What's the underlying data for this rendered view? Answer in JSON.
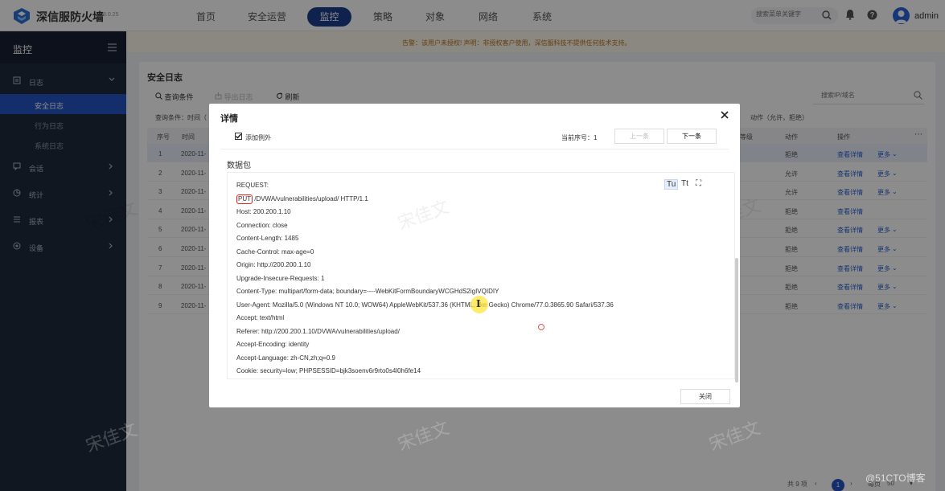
{
  "header": {
    "brand": "深信服防火墙",
    "version": "8.0.25",
    "nav": [
      "首页",
      "安全运营",
      "监控",
      "策略",
      "对象",
      "网络",
      "系统"
    ],
    "nav_active": "监控",
    "search_placeholder": "搜索菜单关键字",
    "username": "admin"
  },
  "sidebar": {
    "title": "监控",
    "items": [
      {
        "label": "日志",
        "icon": "log-icon"
      },
      {
        "label": "会话",
        "icon": "session-icon"
      },
      {
        "label": "统计",
        "icon": "stats-icon"
      },
      {
        "label": "报表",
        "icon": "report-icon"
      },
      {
        "label": "设备",
        "icon": "device-icon"
      }
    ],
    "subitems": [
      "安全日志",
      "行为日志",
      "系统日志"
    ],
    "active_subitem": "安全日志"
  },
  "notice": "告警：该用户未授权!  声明：非授权客户使用，深信服科技不提供任何技术支持。",
  "panel": {
    "title": "安全日志",
    "toolbar": [
      "查询条件",
      "导出日志",
      "刷新"
    ],
    "search_placeholder": "搜索IP/域名",
    "condition": "查询条件：时间（",
    "condition_right": "动作（允许，拒绝）",
    "columns": [
      "序号",
      "时间",
      "等级",
      "动作",
      "操作"
    ],
    "rows": [
      {
        "no": "1",
        "time": "2020-11-",
        "action": "拒绝",
        "op1": "查看详情",
        "op2": "更多"
      },
      {
        "no": "2",
        "time": "2020-11-",
        "action": "允许",
        "op1": "查看详情",
        "op2": "更多"
      },
      {
        "no": "3",
        "time": "2020-11-",
        "action": "允许",
        "op1": "查看详情",
        "op2": "更多"
      },
      {
        "no": "4",
        "time": "2020-11-",
        "action": "拒绝",
        "op1": "查看详情",
        "op2": ""
      },
      {
        "no": "5",
        "time": "2020-11-",
        "action": "拒绝",
        "op1": "查看详情",
        "op2": "更多"
      },
      {
        "no": "6",
        "time": "2020-11-",
        "action": "拒绝",
        "op1": "查看详情",
        "op2": "更多"
      },
      {
        "no": "7",
        "time": "2020-11-",
        "action": "拒绝",
        "op1": "查看详情",
        "op2": "更多"
      },
      {
        "no": "8",
        "time": "2020-11-",
        "action": "拒绝",
        "op1": "查看详情",
        "op2": "更多"
      },
      {
        "no": "9",
        "time": "2020-11-",
        "action": "拒绝",
        "op1": "查看详情",
        "op2": "更多"
      }
    ],
    "pager": {
      "total": "共 9 项",
      "current": "1",
      "per_page_label": "每页",
      "per_page": "50"
    }
  },
  "modal": {
    "title": "详情",
    "add_exception": "添加例外",
    "seq": "当前序号：1",
    "prev": "上一条",
    "next": "下一条",
    "section": "数据包",
    "request_label": "REQUEST:",
    "method": "PUT",
    "request_line_rest": " /DVWA/vulnerabilities/upload/ HTTP/1.1",
    "headers": [
      "Host: 200.200.1.10",
      "Connection: close",
      "Content-Length: 1485",
      "Cache-Control: max-age=0",
      "Origin: http://200.200.1.10",
      "Upgrade-Insecure-Requests: 1",
      "Content-Type: multipart/form-data; boundary=----WebKitFormBoundaryWCGHdS2igIVQIDIY",
      "User-Agent: Mozilla/5.0 (Windows NT 10.0; WOW64) AppleWebKit/537.36 (KHTML, like Gecko) Chrome/77.0.3865.90 Safari/537.36",
      "Accept: text/html",
      "Referer: http://200.200.1.10/DVWA/vulnerabilities/upload/",
      "Accept-Encoding: identity",
      "Accept-Language: zh-CN,zh;q=0.9",
      "Cookie: security=low; PHPSESSID=bjk3soenv6r9rto0s4l0h6fe14"
    ],
    "format_buttons": [
      "Tu",
      "Tt",
      "⛶"
    ],
    "close": "关闭"
  },
  "watermark": "宋佳文",
  "credit": "@51CTO博客"
}
